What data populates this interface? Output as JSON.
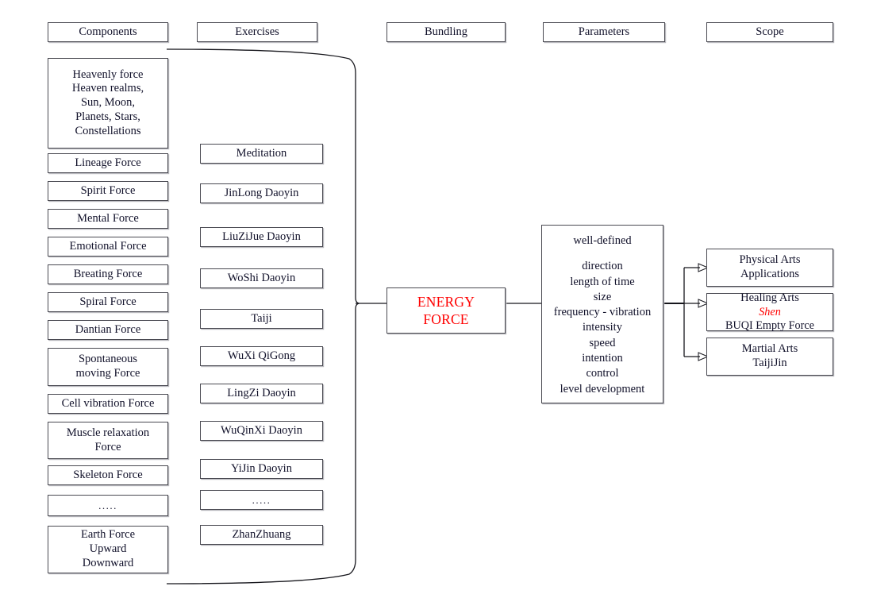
{
  "diagram": {
    "title": "Energy Force Structure Diagram",
    "accent_red": "#ff0000",
    "box_border": "#4a4a52",
    "text_color": "#11112a"
  },
  "headers": [
    {
      "id": "components",
      "label": "Components"
    },
    {
      "id": "exercises",
      "label": "Exercises"
    },
    {
      "id": "bundling",
      "label": "Bundling"
    },
    {
      "id": "parameters",
      "label": "Parameters"
    },
    {
      "id": "scope",
      "label": "Scope"
    }
  ],
  "components": [
    {
      "lines": [
        "Heavenly force",
        "Heaven realms,",
        "Sun, Moon,",
        "Planets, Stars,",
        "Constellations"
      ]
    },
    {
      "lines": [
        "Lineage Force"
      ]
    },
    {
      "lines": [
        "Spirit Force"
      ]
    },
    {
      "lines": [
        "Mental Force"
      ]
    },
    {
      "lines": [
        "Emotional Force"
      ]
    },
    {
      "lines": [
        "Breating Force"
      ]
    },
    {
      "lines": [
        "Spiral Force"
      ]
    },
    {
      "lines": [
        "Dantian Force"
      ]
    },
    {
      "lines": [
        "Spontaneous",
        "moving Force"
      ]
    },
    {
      "lines": [
        "Cell vibration Force"
      ]
    },
    {
      "lines": [
        "Muscle relaxation",
        "Force"
      ]
    },
    {
      "lines": [
        "Skeleton Force"
      ]
    },
    {
      "lines": [
        "....."
      ]
    },
    {
      "lines": [
        "Earth Force",
        "Upward",
        "Downward"
      ]
    }
  ],
  "exercises": [
    {
      "lines": [
        "Meditation"
      ]
    },
    {
      "lines": [
        "JinLong Daoyin"
      ]
    },
    {
      "lines": [
        "LiuZiJue Daoyin"
      ]
    },
    {
      "lines": [
        "WoShi Daoyin"
      ]
    },
    {
      "lines": [
        "Taiji"
      ]
    },
    {
      "lines": [
        "WuXi QiGong"
      ]
    },
    {
      "lines": [
        "LingZi Daoyin"
      ]
    },
    {
      "lines": [
        "WuQinXi Daoyin"
      ]
    },
    {
      "lines": [
        "YiJin Daoyin"
      ]
    },
    {
      "lines": [
        "....."
      ]
    },
    {
      "lines": [
        "ZhanZhuang"
      ]
    }
  ],
  "bundling": {
    "label_line1": "ENERGY",
    "label_line2": "FORCE"
  },
  "parameters": {
    "heading": "well-defined",
    "items": [
      "direction",
      "length of time",
      "size",
      "frequency - vibration",
      "intensity",
      "speed",
      "intention",
      "control",
      "level development"
    ]
  },
  "scope": [
    {
      "lines": [
        "Physical Arts",
        "Applications"
      ],
      "red_prefix": ""
    },
    {
      "lines": [
        "Healing Arts",
        "BUQI Empty Force"
      ],
      "red_prefix": "Shen"
    },
    {
      "lines": [
        "Martial Arts",
        "TaijiJin"
      ],
      "red_prefix": ""
    }
  ]
}
